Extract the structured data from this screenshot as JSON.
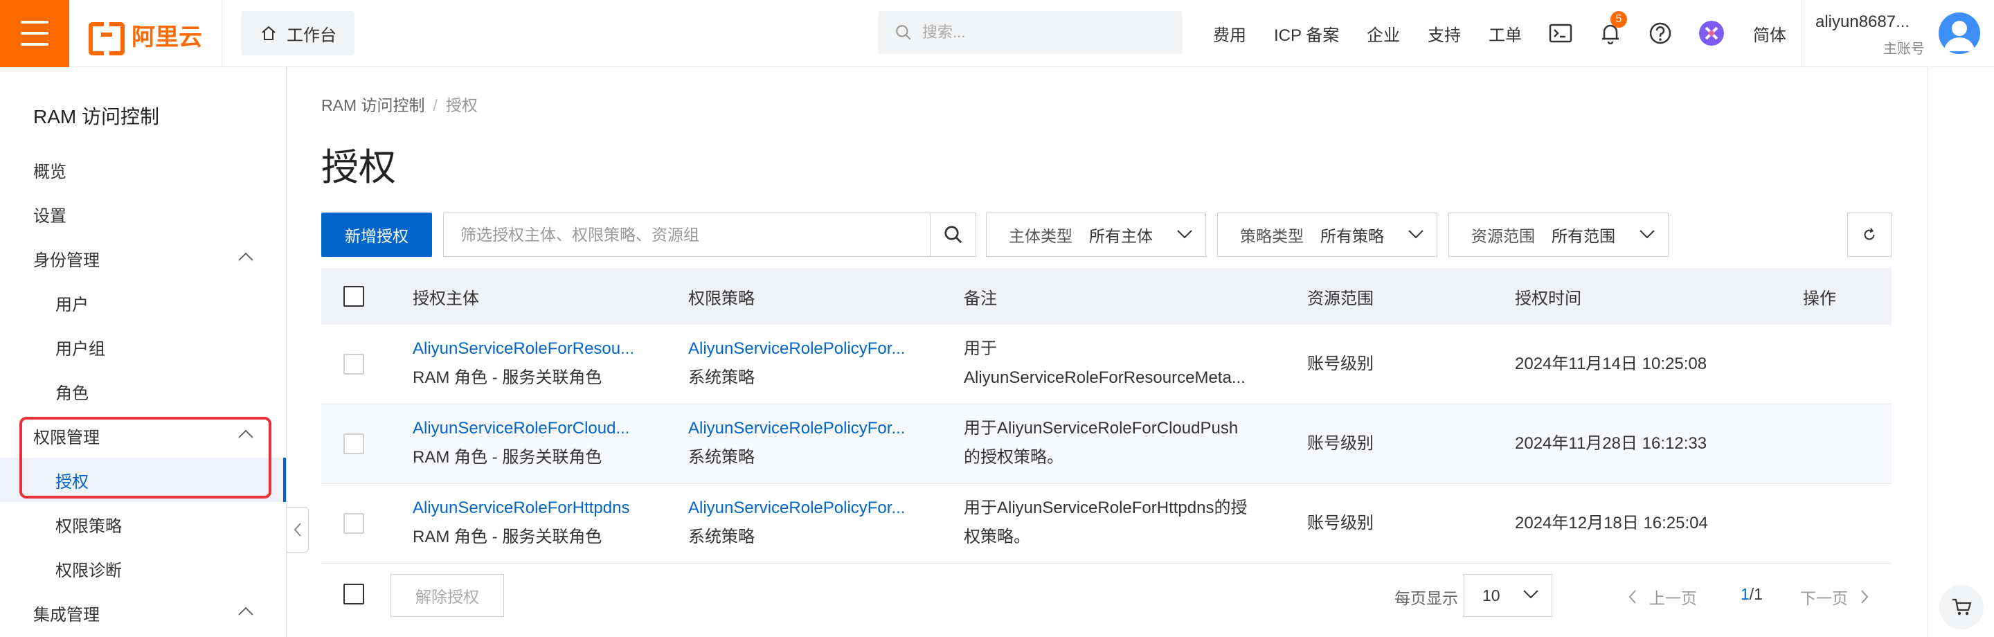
{
  "header": {
    "logo_text": "阿里云",
    "workbench_label": "工作台",
    "search_placeholder": "搜索...",
    "nav": [
      "费用",
      "ICP 备案",
      "企业",
      "支持",
      "工单"
    ],
    "notification_count": "5",
    "language": "简体",
    "user_name": "aliyun8687...",
    "user_role": "主账号",
    "icons": [
      "menu-icon",
      "home-icon",
      "search-icon",
      "terminal-icon",
      "bell-icon",
      "help-icon",
      "app-icon",
      "avatar"
    ],
    "accent_color": "#ff6a00"
  },
  "sidebar": {
    "title": "RAM 访问控制",
    "items": [
      {
        "label": "概览",
        "level": 0
      },
      {
        "label": "设置",
        "level": 0
      },
      {
        "label": "身份管理",
        "level": 0,
        "expanded": true
      },
      {
        "label": "用户",
        "level": 1
      },
      {
        "label": "用户组",
        "level": 1
      },
      {
        "label": "角色",
        "level": 1
      },
      {
        "label": "权限管理",
        "level": 0,
        "expanded": true
      },
      {
        "label": "授权",
        "level": 1,
        "active": true
      },
      {
        "label": "权限策略",
        "level": 1
      },
      {
        "label": "权限诊断",
        "level": 1
      },
      {
        "label": "集成管理",
        "level": 0,
        "expanded": true
      }
    ]
  },
  "main": {
    "breadcrumb": [
      "RAM 访问控制",
      "授权"
    ],
    "title": "授权",
    "add_button": "新增授权",
    "filter_placeholder": "筛选授权主体、权限策略、资源组",
    "filters": [
      {
        "label": "主体类型",
        "value": "所有主体"
      },
      {
        "label": "策略类型",
        "value": "所有策略"
      },
      {
        "label": "资源范围",
        "value": "所有范围"
      }
    ],
    "columns": [
      "授权主体",
      "权限策略",
      "备注",
      "资源范围",
      "授权时间",
      "操作"
    ],
    "rows": [
      {
        "principal": "AliyunServiceRoleForResou...",
        "principal_type": "RAM 角色 - 服务关联角色",
        "policy": "AliyunServiceRolePolicyFor...",
        "policy_type": "系统策略",
        "note_line1": "用于",
        "note_line2": "AliyunServiceRoleForResourceMeta...",
        "scope": "账号级别",
        "time": "2024年11月14日 10:25:08"
      },
      {
        "principal": "AliyunServiceRoleForCloud...",
        "principal_type": "RAM 角色 - 服务关联角色",
        "policy": "AliyunServiceRolePolicyFor...",
        "policy_type": "系统策略",
        "note_line1": "用于AliyunServiceRoleForCloudPush",
        "note_line2": "的授权策略。",
        "scope": "账号级别",
        "time": "2024年11月28日 16:12:33"
      },
      {
        "principal": "AliyunServiceRoleForHttpdns",
        "principal_type": "RAM 角色 - 服务关联角色",
        "policy": "AliyunServiceRolePolicyFor...",
        "policy_type": "系统策略",
        "note_line1": "用于AliyunServiceRoleForHttpdns的授",
        "note_line2": "权策略。",
        "scope": "账号级别",
        "time": "2024年12月18日 16:25:04"
      }
    ],
    "revoke_button": "解除授权",
    "page_size_label": "每页显示",
    "page_size": "10",
    "prev_label": "上一页",
    "page_current": "1",
    "page_total": "/1",
    "next_label": "下一页",
    "primary_color": "#0064c8",
    "highlight_color": "#e8313b"
  }
}
